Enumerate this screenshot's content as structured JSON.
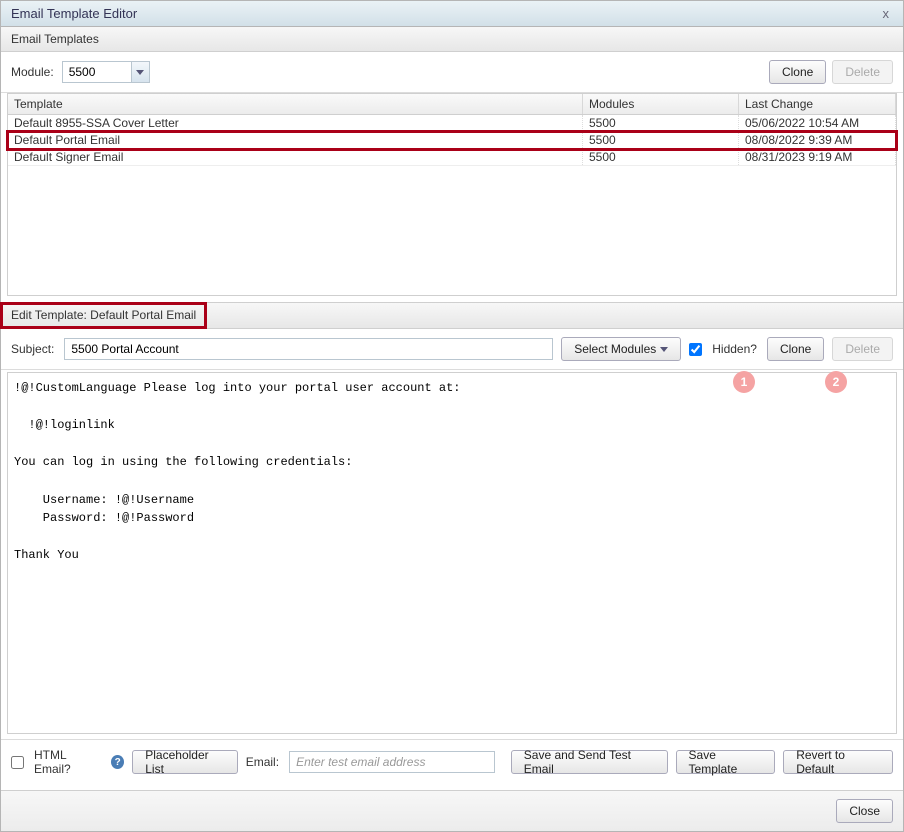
{
  "window": {
    "title": "Email Template Editor",
    "close_glyph": "x"
  },
  "panels": {
    "templates_header": "Email Templates"
  },
  "top_toolbar": {
    "module_label": "Module:",
    "module_value": "5500",
    "clone_label": "Clone",
    "delete_label": "Delete"
  },
  "grid": {
    "headers": {
      "template": "Template",
      "modules": "Modules",
      "last_change": "Last Change"
    },
    "rows": [
      {
        "template": "Default 8955-SSA Cover Letter",
        "modules": "5500",
        "last_change": "05/06/2022 10:54 AM",
        "selected": false
      },
      {
        "template": "Default Portal Email",
        "modules": "5500",
        "last_change": "08/08/2022 9:39 AM",
        "selected": true
      },
      {
        "template": "Default Signer Email",
        "modules": "5500",
        "last_change": "08/31/2023 9:19 AM",
        "selected": false
      }
    ]
  },
  "edit_panel": {
    "header": "Edit Template: Default Portal Email",
    "subject_label": "Subject:",
    "subject_value": "5500 Portal Account",
    "select_modules_label": "Select Modules",
    "hidden_label": "Hidden?",
    "hidden_checked": true,
    "clone_label": "Clone",
    "delete_label": "Delete",
    "body_text": "!@!CustomLanguage Please log into your portal user account at:\n\n  !@!loginlink\n\nYou can log in using the following credentials:\n\n    Username: !@!Username\n    Password: !@!Password\n\nThank You"
  },
  "bottom_bar": {
    "html_email_label": "HTML Email?",
    "html_email_checked": false,
    "placeholder_list_label": "Placeholder List",
    "email_label": "Email:",
    "test_email_placeholder": "Enter test email address",
    "save_send_label": "Save and Send Test Email",
    "save_template_label": "Save Template",
    "revert_label": "Revert to Default"
  },
  "footer": {
    "close_label": "Close"
  },
  "annotations": {
    "badge1": "1",
    "badge2": "2"
  }
}
